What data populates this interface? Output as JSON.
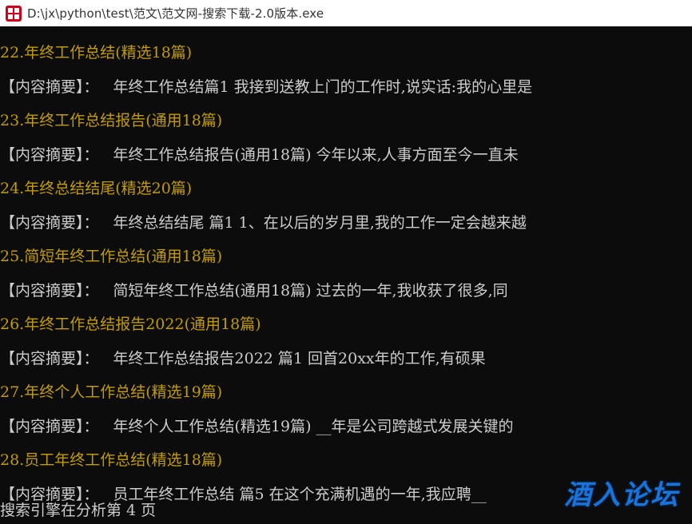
{
  "window": {
    "title": "D:\\jx\\python\\test\\范文\\范文网-搜索下载-2.0版本.exe",
    "icon": "app-icon"
  },
  "entries": [
    {
      "title": "22.年终工作总结(精选18篇)",
      "tag": "【内容摘要】：",
      "summary": "年终工作总结篇1 我接到送教上门的工作时,说实话:我的心里是"
    },
    {
      "title": "23.年终工作总结报告(通用18篇)",
      "tag": "【内容摘要】：",
      "summary": "年终工作总结报告(通用18篇) 今年以来,人事方面至今一直未"
    },
    {
      "title": "24.年终总结结尾(精选20篇)",
      "tag": "【内容摘要】：",
      "summary": "年终总结结尾 篇1 1、在以后的岁月里,我的工作一定会越来越"
    },
    {
      "title": "25.简短年终工作总结(通用18篇)",
      "tag": "【内容摘要】：",
      "summary": "简短年终工作总结(通用18篇) 过去的一年,我收获了很多,同"
    },
    {
      "title": "26.年终工作总结报告2022(通用18篇)",
      "tag": "【内容摘要】：",
      "summary": "年终工作总结报告2022 篇1 回首20xx年的工作,有硕果"
    },
    {
      "title": "27.年终个人工作总结(精选19篇)",
      "tag": "【内容摘要】：",
      "summary": "年终个人工作总结(精选19篇) __年是公司跨越式发展关键的"
    },
    {
      "title": "28.员工年终工作总结(精选18篇)",
      "tag": "【内容摘要】：",
      "summary": "员工年终工作总结 篇5 在这个充满机遇的一年,我应聘__"
    }
  ],
  "status": "搜索引擎在分析第 4 页",
  "watermark": "酒入论坛",
  "colors": {
    "background": "#0c0c0c",
    "title_text": "#c19c00",
    "summary_text": "#cccccc",
    "watermark": "#1a73d8"
  }
}
